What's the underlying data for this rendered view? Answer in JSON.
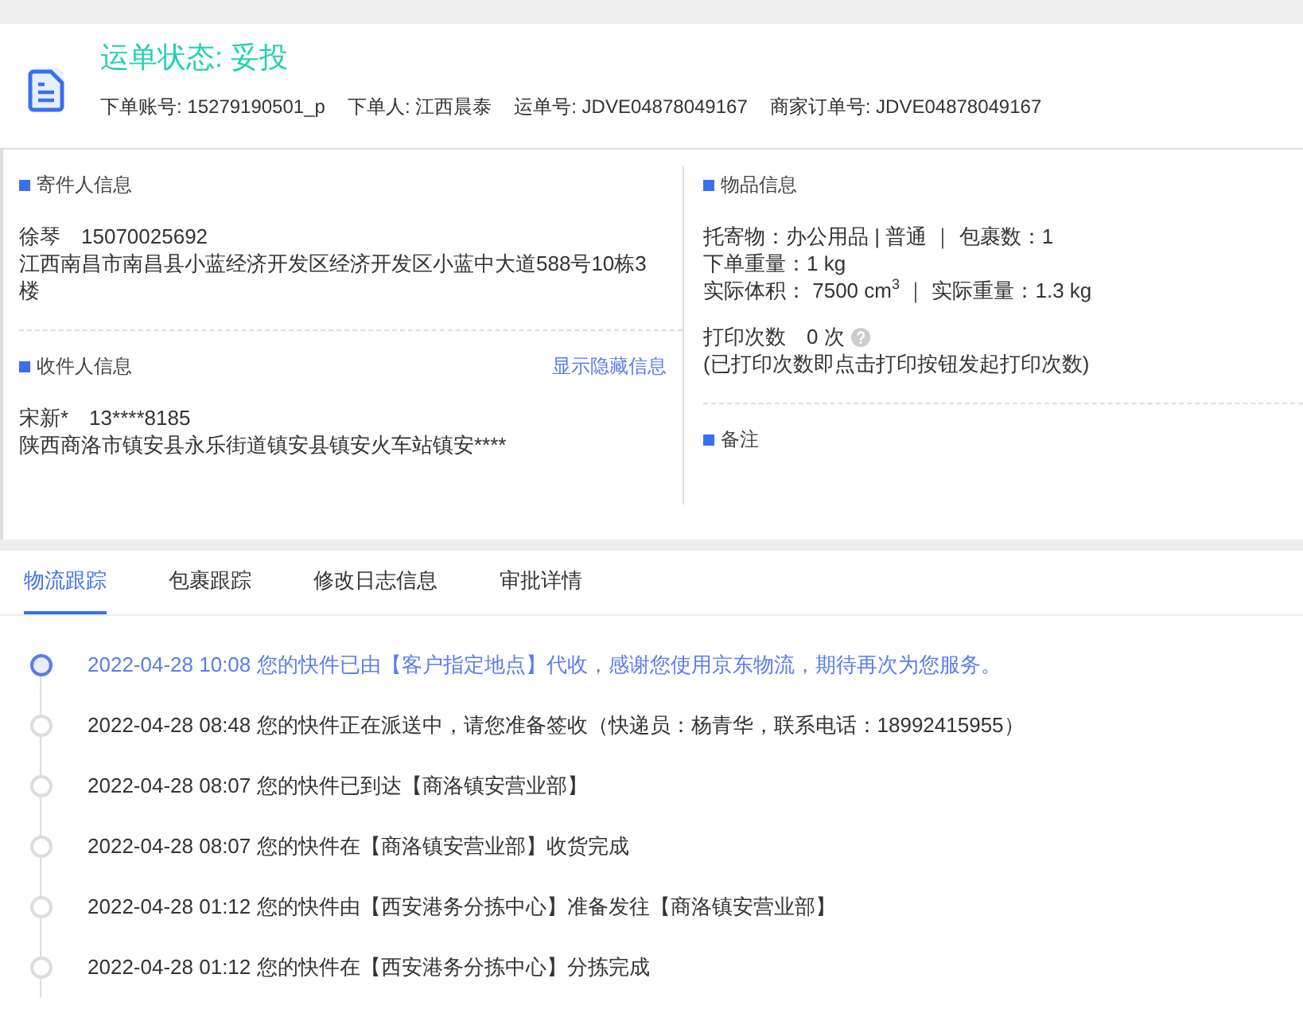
{
  "header": {
    "status": "运单状态: 妥投",
    "meta": [
      {
        "label": "下单账号:",
        "value": "15279190501_p"
      },
      {
        "label": "下单人:",
        "value": "江西晨泰"
      },
      {
        "label": "运单号:",
        "value": "JDVE04878049167"
      },
      {
        "label": "商家订单号:",
        "value": "JDVE04878049167"
      }
    ]
  },
  "sender": {
    "title": "寄件人信息",
    "name": "徐琴",
    "phone": "15070025692",
    "address": "江西南昌市南昌县小蓝经济开发区经济开发区小蓝中大道588号10栋3楼"
  },
  "receiver": {
    "title": "收件人信息",
    "link": "显示隐藏信息",
    "name": "宋新*",
    "phone": "13****8185",
    "address": "陕西商洛市镇安县永乐街道镇安县镇安火车站镇安****"
  },
  "goods": {
    "title": "物品信息",
    "lines": [
      "托寄物：办公用品 | 普通 ｜ 包裹数：1",
      "下单重量：1 kg",
      "实际体积：  7500 cm$^{3}$ ｜ 实际重量：1.3 kg"
    ],
    "print_label": "打印次数",
    "print_count": "0 次",
    "print_note": "(已打印次数即点击打印按钮发起打印次数)"
  },
  "remark": {
    "title": "备注"
  },
  "tabs": [
    {
      "label": "物流跟踪",
      "selected": true
    },
    {
      "label": "包裹跟踪",
      "selected": false
    },
    {
      "label": "修改日志信息",
      "selected": false
    },
    {
      "label": "审批详情",
      "selected": false
    }
  ],
  "timeline": [
    {
      "text": "2022-04-28 10:08 您的快件已由【客户指定地点】代收，感谢您使用京东物流，期待再次为您服务。",
      "current": true
    },
    {
      "text": "2022-04-28 08:48 您的快件正在派送中，请您准备签收（快递员：杨青华，联系电话：18992415955）",
      "current": false
    },
    {
      "text": "2022-04-28 08:07 您的快件已到达【商洛镇安营业部】",
      "current": false
    },
    {
      "text": "2022-04-28 08:07 您的快件在【商洛镇安营业部】收货完成",
      "current": false
    },
    {
      "text": "2022-04-28 01:12 您的快件由【西安港务分拣中心】准备发往【商洛镇安营业部】",
      "current": false
    },
    {
      "text": "2022-04-28 01:12 您的快件在【西安港务分拣中心】分拣完成",
      "current": false
    }
  ]
}
